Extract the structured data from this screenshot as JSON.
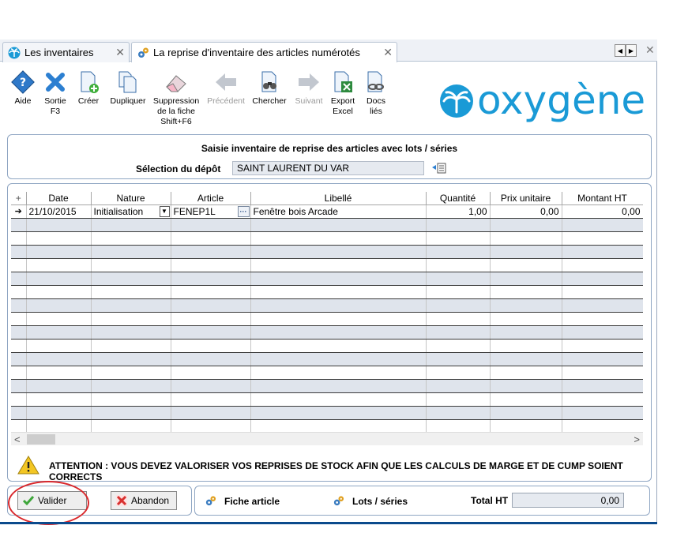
{
  "tabs": [
    {
      "label": "Les inventaires",
      "icon": "palm-icon"
    },
    {
      "label": "La reprise d'inventaire des articles numérotés",
      "icon": "gears-icon"
    }
  ],
  "toolbar": [
    {
      "key": "aide",
      "label": "Aide",
      "icon": "help-icon",
      "disabled": false
    },
    {
      "key": "sortie",
      "label": "Sortie F3",
      "icon": "exit-icon",
      "disabled": false
    },
    {
      "key": "creer",
      "label": "Créer",
      "icon": "create-icon",
      "disabled": false
    },
    {
      "key": "dupliquer",
      "label": "Dupliquer",
      "icon": "duplicate-icon",
      "disabled": false
    },
    {
      "key": "suppression",
      "label": "Suppression de la fiche Shift+F6",
      "icon": "eraser-icon",
      "disabled": false
    },
    {
      "key": "precedent",
      "label": "Précédent",
      "icon": "arrow-left-icon",
      "disabled": true
    },
    {
      "key": "chercher",
      "label": "Chercher",
      "icon": "binoculars-icon",
      "disabled": false
    },
    {
      "key": "suivant",
      "label": "Suivant",
      "icon": "arrow-right-icon",
      "disabled": true
    },
    {
      "key": "export",
      "label": "Export Excel",
      "icon": "excel-icon",
      "disabled": false
    },
    {
      "key": "docs",
      "label": "Docs liés",
      "icon": "linked-docs-icon",
      "disabled": false
    }
  ],
  "logo": {
    "text": "oxygène",
    "color": "#1a9ad6"
  },
  "header": {
    "title": "Saisie inventaire de reprise des articles avec lots / séries",
    "depot_label": "Sélection du dépôt",
    "depot_value": "SAINT LAURENT DU VAR"
  },
  "grid": {
    "columns": [
      "Date",
      "Nature",
      "Article",
      "Libellé",
      "Quantité",
      "Prix unitaire",
      "Montant HT"
    ],
    "rows": [
      {
        "date": "21/10/2015",
        "nature": "Initialisation",
        "article": "FENEP1L",
        "libelle": "Fenêtre bois Arcade",
        "quantite": "1,00",
        "prix": "0,00",
        "montant": "0,00"
      }
    ],
    "empty_rows": 16
  },
  "warning": "ATTENTION : VOUS DEVEZ VALORISER VOS REPRISES DE STOCK AFIN QUE LES CALCULS DE MARGE ET DE CUMP SOIENT CORRECTS",
  "footer": {
    "valider": "Valider",
    "abandon": "Abandon",
    "fiche_article": "Fiche article",
    "lots_series": "Lots / séries",
    "total_label": "Total HT",
    "total_value": "0,00"
  },
  "colors": {
    "accent": "#1a9ad6",
    "panel_border": "#8fa6c3",
    "row_alt": "#dfe4ec",
    "highlight_circle": "#d9282c"
  }
}
